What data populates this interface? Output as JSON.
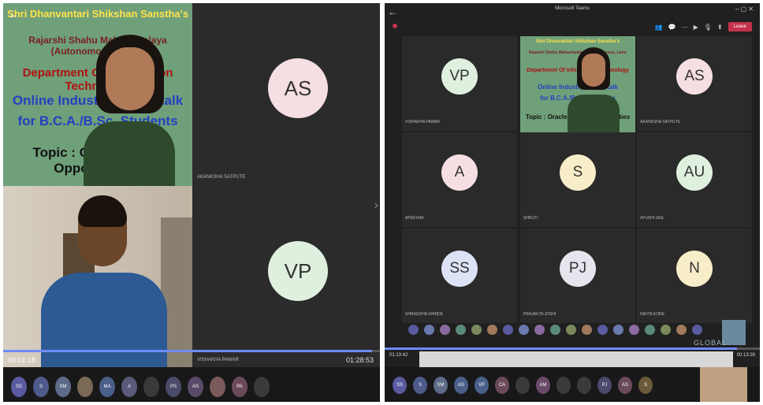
{
  "left": {
    "slide": {
      "line1": "Shri Dhanvantari Shikshan Sanstha's",
      "line2": "Rajarshi Shahu Mahavidyalaya (Autonomous), Latur",
      "line3": "Department Of Information Technology",
      "line4": "Online Industry Expert talk",
      "line5": "for B.C.A./B.Sc. Students",
      "line6": "Topic : Oracle Cloud Opportunities"
    },
    "cam_time": "00:01:18",
    "tiles": [
      {
        "initials": "AS",
        "name": "AKANKSHA SATPUTE",
        "color": "#f6dfe3"
      },
      {
        "initials": "VP",
        "name": "VISHAKHA PAWAR",
        "color": "#dff0df"
      }
    ],
    "time": "01:28:53",
    "progress": 0.98,
    "bottom_pills": [
      {
        "label": "SS",
        "color": "#5a5aa0"
      },
      {
        "label": "S",
        "color": "#4e5a8a"
      },
      {
        "label": "SM",
        "color": "#5d6a88"
      },
      {
        "label": "",
        "color": "#7a6a55"
      },
      {
        "label": "MA",
        "color": "#4a5f8a"
      },
      {
        "label": "A",
        "color": "#5a5a7a"
      },
      {
        "label": "",
        "color": "#3a3a3a"
      },
      {
        "label": "PS",
        "color": "#4a4a6a"
      },
      {
        "label": "AS",
        "color": "#5a4a6a"
      },
      {
        "label": "",
        "color": "#7a5a5a"
      },
      {
        "label": "PA",
        "color": "#6a4a5a"
      },
      {
        "label": "",
        "color": "#3a3a3a"
      }
    ]
  },
  "right": {
    "title": "Microsoft Teams",
    "leave": "Leave",
    "slide": {
      "line1": "Shri Dhanvantari Shikshan Sanstha's",
      "line2": "Rajarshi Shahu Mahavidyalaya (Autonomous), Latur",
      "line3": "Department Of Information Technology",
      "line4": "Online Industry Expert talk",
      "line5": "for B.C.A./B.Sc. Students",
      "line6": "Topic : Oracle Cloud Opportunities"
    },
    "tiles": [
      {
        "initials": "VP",
        "name": "VISHAKHA PAWAR",
        "color": "#dff0df"
      },
      {
        "initials": "AS",
        "name": "AKANKSHA SATPUTE",
        "color": "#f6dfe3"
      },
      {
        "initials": "A",
        "name": "APEKSHA",
        "color": "#f6dfe3"
      },
      {
        "initials": "S",
        "name": "SHRUTI",
        "color": "#f7edc9"
      },
      {
        "initials": "AU",
        "name": "AYUSHI UKE",
        "color": "#dff0df"
      },
      {
        "initials": "SS",
        "name": "SHRADDHA SHINDE",
        "color": "#dde3f5"
      },
      {
        "initials": "PJ",
        "name": "PRAJAKTA JOSHI",
        "color": "#e5e5ee"
      },
      {
        "initials": "N",
        "name": "NIKITA KORE",
        "color": "#f7edc9"
      }
    ],
    "strip_count": 19,
    "time_left": "01:13:42",
    "time_right": "00:13:28",
    "progress": 0.94,
    "watermark": "GLOBAL",
    "bottom_pills": [
      {
        "label": "SS",
        "color": "#5a5aa0"
      },
      {
        "label": "S",
        "color": "#4e5a8a"
      },
      {
        "label": "SM",
        "color": "#5d6a88"
      },
      {
        "label": "AS",
        "color": "#4a5f8a"
      },
      {
        "label": "VP",
        "color": "#4a5f8a"
      },
      {
        "label": "CA",
        "color": "#6a4a5a"
      },
      {
        "label": "",
        "color": "#3a3a3a"
      },
      {
        "label": "AM",
        "color": "#6a4a6a"
      },
      {
        "label": "",
        "color": "#3a3a3a"
      },
      {
        "label": "",
        "color": "#3a3a3a"
      },
      {
        "label": "PJ",
        "color": "#4a4a6a"
      },
      {
        "label": "AS",
        "color": "#6a4a5a"
      },
      {
        "label": "S",
        "color": "#6a5a3a"
      }
    ]
  }
}
